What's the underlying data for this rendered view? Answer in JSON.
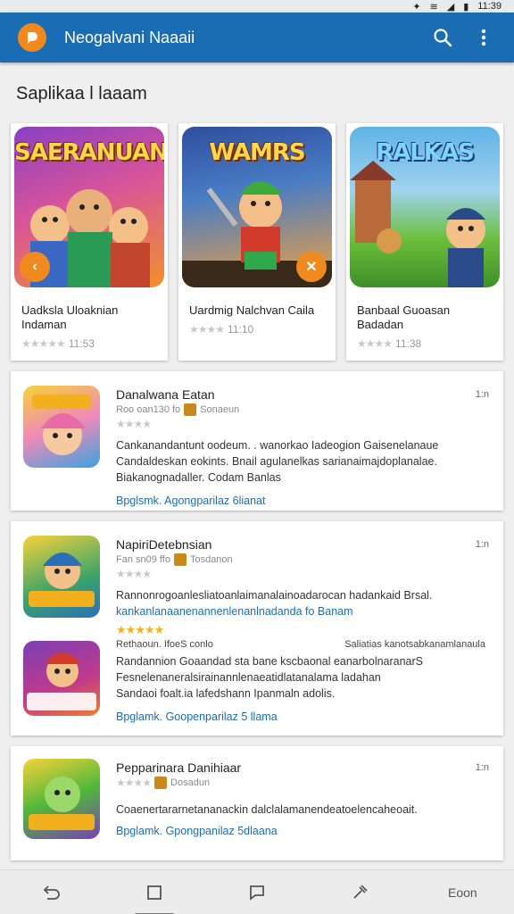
{
  "status_bar": {
    "time": "11:39"
  },
  "app_bar": {
    "title": "Neogalvani Naaaii",
    "logo_icon": "app-logo-icon",
    "search_icon": "search-icon",
    "menu_icon": "more-vert-icon",
    "color": "#1b6db3"
  },
  "section": {
    "title": "Saplikaa l laaam"
  },
  "featured": [
    {
      "art_title": "SAERANUAN",
      "name": "Uadksla Uloaknian Indaman",
      "rating": "11:53",
      "badge": "‹",
      "badge_side": "left",
      "colors": [
        "#7a3fb5",
        "#f07c2a"
      ]
    },
    {
      "art_title": "WAMRS",
      "name": "Uardmig Nalchvan Caila",
      "rating": "11:10",
      "badge": "✕",
      "badge_side": "right",
      "colors": [
        "#2e6fb8",
        "#f4a33a"
      ]
    },
    {
      "art_title": "RALKAS",
      "name": "Banbaal Guoasan Badadan",
      "rating": "11:38",
      "badge": "",
      "badge_side": "none",
      "colors": [
        "#4f9fd6",
        "#6bbf3b"
      ]
    }
  ],
  "list": [
    {
      "title": "Danalwana Eatan",
      "meta1": "Roo oan130 fo",
      "meta2": "Sonaeun",
      "more": "1:n",
      "desc": [
        "Cankanandantunt oodeum. .  wanorkao Iadeogion Gaisenelanaue",
        "Candaldeskan eokints. Bnail agulanelkas sarianaimajdoplanalae.",
        "Biakanognadaller. Codam Banlas"
      ],
      "link": "Bpglsmk. Agongparilaz 6lianat"
    },
    {
      "title": "NapiriDetebnsian",
      "meta1": "Fan  sn09 ffo",
      "meta2": "Tosdanon",
      "more": "1:n",
      "desc": [
        "Rannonrogoanlesliatoanlaimanalainoadarocan hadankaid Brsal.",
        "kankanlanaanenannenlenanlnadanda fo Banam"
      ],
      "sub_rating_label": "Rethaoun. IfoeS conlo",
      "sub_rating_right": "Saliatias kanotsabkanamlanaula",
      "desc2": [
        "Randannion Goaandad sta bane kscbaonal eanarbolnaranarS",
        "Fesnelenaneralsirainannlenaeatidlatanalama ladahan",
        "Sandaoi foalt.ia lafedshann Ipanmaln adolis."
      ],
      "link": "Bpglamk. Goopenparilaz 5 llama"
    },
    {
      "title": "Pepparinara Danihiaar",
      "meta1": "",
      "meta2": "Dosadun",
      "more": "1:n",
      "desc": [
        "Coaenertararnetananackin dalclalamanendeatoelencaheoait."
      ],
      "link": "Bpglamk. Gpongpanilaz 5dlaana"
    }
  ],
  "nav": {
    "back_icon": "back-icon",
    "home_icon": "home-icon",
    "chat_icon": "chat-icon",
    "tools_icon": "tools-icon",
    "last_label": "Eoon"
  }
}
